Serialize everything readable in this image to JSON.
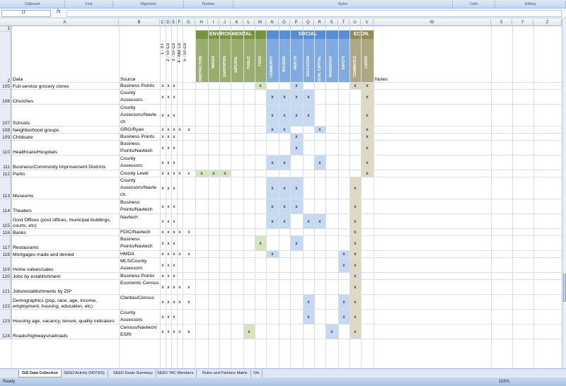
{
  "ribbon": {
    "groups": [
      "Clipboard",
      "Font",
      "Alignment",
      "Number",
      "Styles",
      "Cells",
      "Editing"
    ]
  },
  "name_box": "I7",
  "fx_label": "fx",
  "col_headers": [
    "A",
    "B",
    "C",
    "D",
    "E",
    "F",
    "G",
    "H",
    "I",
    "J",
    "K",
    "L",
    "M",
    "N",
    "O",
    "P",
    "Q",
    "R",
    "S",
    "T",
    "U",
    "V",
    "W",
    "X",
    "Y",
    "Z"
  ],
  "header": {
    "row1": "1",
    "row2": "2",
    "data": "Data",
    "source": "Source",
    "notes": "Notes",
    "bands": {
      "environmental": "ENVIRONMENTAL",
      "social": "SOCIAL",
      "econ": "ECON."
    },
    "scale_cols": [
      "1 - ST",
      "2 - ST-Co",
      "3 - ST-Co",
      "4 - Mid Co",
      "5 - ST-Co"
    ],
    "env_cols": [
      "CONSTRUCTION",
      "WATER",
      "SANITATION",
      "NATURAL",
      "PUBLIC",
      "FOOD"
    ],
    "social_cols": [
      "COMMUNITY",
      "HOUSING",
      "HEALTH",
      "EDUCATION",
      "SOCIAL CAPITAL",
      "TRANSPORT",
      "SAFETY"
    ],
    "econ_cols": [
      "COMMERCE",
      "LABOR"
    ]
  },
  "colors": {
    "environmental": "#77933c",
    "social": "#558ed5",
    "econ": "#948a54",
    "env_fill": "#d7e4bd",
    "social_fill": "#c6d9f1",
    "econ_fill": "#ddd9c3"
  },
  "rows": [
    {
      "num": "105",
      "data": "Full-service grocery stores",
      "source": [
        "Business Points"
      ],
      "scale": "x|x|x||",
      "env": "|||||x",
      "soc": "||x||||",
      "eco": "x|x"
    },
    {
      "num": "106",
      "data": "Churches",
      "source": [
        "County",
        "Assessors"
      ],
      "scale": "x|x|x||",
      "env": "||||||",
      "soc": "x|x|x|x|||",
      "eco": "|x"
    },
    {
      "num": "107",
      "data": "Schools",
      "source": [
        "County",
        "Assessors/Navte",
        "ch"
      ],
      "scale": "x|x|x||",
      "env": "||||||",
      "soc": "x|x|x|x|||",
      "eco": "|x"
    },
    {
      "num": "108",
      "data": "Neighborhood groups",
      "source": [
        "GRG/Ryan"
      ],
      "scale": "x|x|x|x|x",
      "env": "||||||",
      "soc": "x|x|||x||",
      "eco": "|x"
    },
    {
      "num": "109",
      "data": "Childcare",
      "source": [
        "Business Points"
      ],
      "scale": "x|x|x||",
      "env": "||||||",
      "soc": "||x||||",
      "eco": "|x"
    },
    {
      "num": "110",
      "data": "Healthcare/Hospitals",
      "source": [
        "Business",
        "Points/Navtech"
      ],
      "scale": "x|x|x||",
      "env": "||||||",
      "soc": "||x||||",
      "eco": "|x"
    },
    {
      "num": "111",
      "data": "Business/Community Improvement Districts",
      "source": [
        "County",
        "Assessors"
      ],
      "scale": "x|x|x||",
      "env": "||||||",
      "soc": "x|x|||x||",
      "eco": "|x"
    },
    {
      "num": "112",
      "data": "Parks",
      "source": [
        "County Level"
      ],
      "scale": "x|x|x|x|x",
      "env": "x|x|x|||",
      "soc": "||||||",
      "eco": "|x"
    },
    {
      "num": "113",
      "data": "Museums",
      "source": [
        "County",
        "Assessors/Navte",
        "ch"
      ],
      "scale": "x|x|x||",
      "env": "||||||",
      "soc": "x|x|x||||",
      "eco": "x|"
    },
    {
      "num": "114",
      "data": "Theaters",
      "source": [
        "Business",
        "Points/Navtech"
      ],
      "scale": "x|x|x||",
      "env": "||||||",
      "soc": "x|x|x||||",
      "eco": "x|"
    },
    {
      "num": "115",
      "data": [
        "Govt Offices (post offices, municipal buildings,",
        "courts, etc)"
      ],
      "source": [
        "Navtech"
      ],
      "scale": "x|x|x||",
      "env": "||||||",
      "soc": "x|x||x|x||",
      "eco": "x|"
    },
    {
      "num": "116",
      "data": "Banks",
      "source": [
        "FDIC/Navtech"
      ],
      "scale": "x|x|x|x|x",
      "env": "||||||",
      "soc": "||||||",
      "eco": "x|"
    },
    {
      "num": "117",
      "data": "Restaurants",
      "source": [
        "Business",
        "Points/Navtech"
      ],
      "scale": "x|x|x||",
      "env": "|||||x",
      "soc": "||x||||",
      "eco": "x|"
    },
    {
      "num": "118",
      "data": "Mortgages made and denied",
      "source": [
        "HMDA"
      ],
      "scale": "x|x|x|x|x",
      "env": "||||||",
      "soc": "x||||||x",
      "eco": "x|"
    },
    {
      "num": "119",
      "data": "Home values/sales",
      "source": [
        "MLS/County",
        "Assessors"
      ],
      "scale": "x|x|x||",
      "env": "||||||",
      "soc": "||||||x",
      "eco": "x|"
    },
    {
      "num": "120",
      "data": "Jobs by establishment",
      "source": [
        "Business Points"
      ],
      "scale": "x|x|x||",
      "env": "||||||",
      "soc": "||||||",
      "eco": "x|"
    },
    {
      "num": "121",
      "data": "Jobs/establishments by ZIP",
      "source": [
        "Economic Census"
      ],
      "scale": "x|x|x|x|x",
      "env": "||||||",
      "soc": "||||||",
      "eco": "x|"
    },
    {
      "num": "122",
      "data": [
        "Demographics (pop, race, age, income,",
        "employment, housing, education, etc)"
      ],
      "source": [
        "Claritas/Census"
      ],
      "scale": "x|x|x|x|x",
      "env": "||||||",
      "soc": "|||x|||x",
      "eco": "x|"
    },
    {
      "num": "123",
      "data": "Housing age, vacancy, tenure, quality indicators",
      "source": [
        "County",
        "Assessors"
      ],
      "scale": "x|x|x||",
      "env": "||||||",
      "soc": "|||x|||x",
      "eco": "x|"
    },
    {
      "num": "124",
      "data": "Roads/highways/railroads",
      "source": [
        "Census/Navtech/",
        "ESRI"
      ],
      "scale": "x|x|x|x|x",
      "env": "||||x|",
      "soc": "|||||x|",
      "eco": "x|"
    }
  ],
  "tabs": [
    "GIS Data Collection",
    "SEED Activity (NOTES)",
    "SEED Goals Summary",
    "SEED TAC Members",
    "Rules and Partners Matrix",
    "Sht"
  ],
  "status": {
    "ready": "Ready",
    "zoom": "115%"
  }
}
